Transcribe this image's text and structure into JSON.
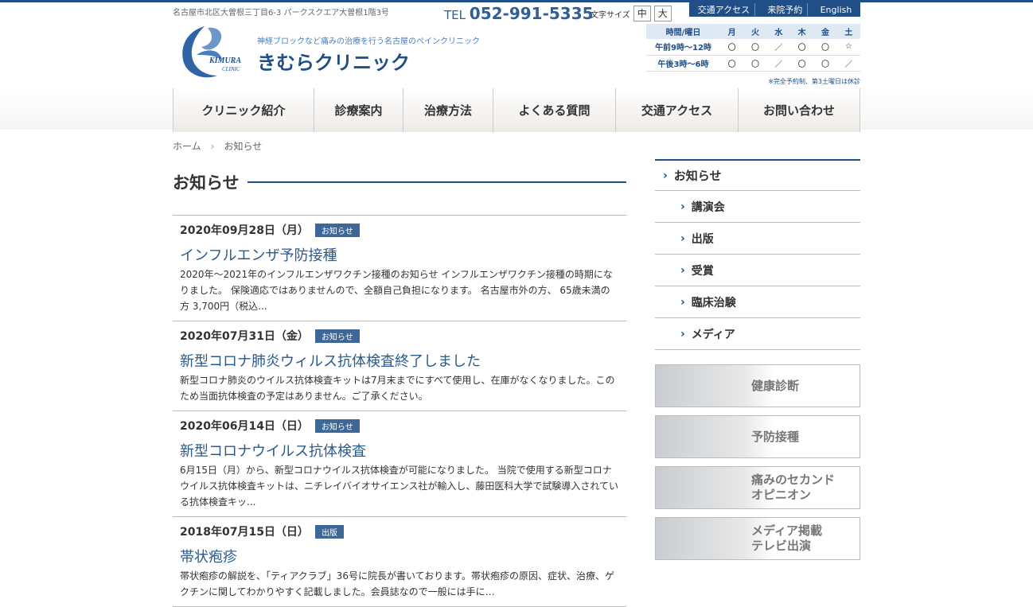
{
  "header": {
    "address": "名古屋市北区大曽根三丁目6-3 パークスクエア大曽根1階3号",
    "tel_prefix": "TEL",
    "tel_number": "052-991-5335",
    "font_size_label": "文字サイズ",
    "font_medium": "中",
    "font_large": "大",
    "top_links": [
      "交通アクセス",
      "来院予約",
      "English"
    ],
    "subtitle": "神経ブロックなど痛みの治療を行う名古屋のペインクリニック",
    "clinic_name": "きむらクリニック",
    "logo_text": "KIMURA CLINIC"
  },
  "hours": {
    "header": [
      "時間/曜日",
      "月",
      "火",
      "水",
      "木",
      "金",
      "土"
    ],
    "rows": [
      {
        "label": "午前9時〜12時",
        "cells": [
          "〇",
          "〇",
          "／",
          "〇",
          "〇",
          "☆"
        ]
      },
      {
        "label": "午後3時〜6時",
        "cells": [
          "〇",
          "〇",
          "／",
          "〇",
          "〇",
          "／"
        ]
      }
    ],
    "note": "※完全予約制、第3土曜日は休診"
  },
  "nav": [
    "クリニック紹介",
    "診療案内",
    "治療方法",
    "よくある質問",
    "交通アクセス",
    "お問い合わせ"
  ],
  "breadcrumb": {
    "home": "ホーム",
    "current": "お知らせ"
  },
  "page_title": "お知らせ",
  "news": [
    {
      "date": "2020年09月28日（月）",
      "tag": "お知らせ",
      "title": "インフルエンザ予防接種",
      "excerpt": "2020年〜2021年のインフルエンザワクチン接種のお知らせ インフルエンザワクチン接種の時期になりました。 保険適応ではありませんので、全額自己負担になります。 名古屋市外の方、 65歳未満の方 3,700円（税込..."
    },
    {
      "date": "2020年07月31日（金）",
      "tag": "お知らせ",
      "title": "新型コロナ肺炎ウィルス抗体検査終了しました",
      "excerpt": "新型コロナ肺炎のウイルス抗体検査キットは7月末までにすべて使用し、在庫がなくなりました。このため当面抗体検査の予定はありません。ご了承ください。"
    },
    {
      "date": "2020年06月14日（日）",
      "tag": "お知らせ",
      "title": "新型コロナウイルス抗体検査",
      "excerpt": "6月15日（月）から、新型コロナウイルス抗体検査が可能になりました。 当院で使用する新型コロナウイルス抗体検査キットは、ニチレイバイオサイエンス社が輸入し、藤田医科大学で試験導入されている抗体検査キッ..."
    },
    {
      "date": "2018年07月15日（日）",
      "tag": "出版",
      "title": "帯状疱疹",
      "excerpt": "帯状疱疹の解説を、「ティアクラブ」36号に院長が書いております。帯状疱疹の原因、症状、治療、ゲクチンに関してわかりやすく記載しました。会員誌なので一般には手に…"
    }
  ],
  "sidebar": {
    "top": "お知らせ",
    "items": [
      "講演会",
      "出版",
      "受賞",
      "臨床治験",
      "メディア"
    ],
    "banners": [
      "健康診断",
      "予防接種",
      "痛みのセカンド\nオピニオン",
      "メディア掲載\nテレビ出演"
    ]
  }
}
